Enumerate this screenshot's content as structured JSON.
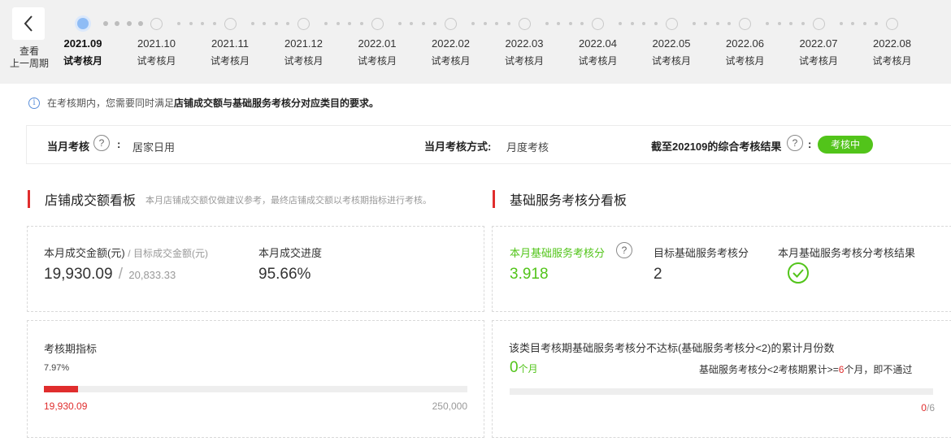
{
  "nav": {
    "prev_label_line1": "查看",
    "prev_label_line2": "上一周期"
  },
  "timeline": [
    {
      "month": "2021.09",
      "status": "试考核月",
      "active": true
    },
    {
      "month": "2021.10",
      "status": "试考核月",
      "active": false
    },
    {
      "month": "2021.11",
      "status": "试考核月",
      "active": false
    },
    {
      "month": "2021.12",
      "status": "试考核月",
      "active": false
    },
    {
      "month": "2022.01",
      "status": "试考核月",
      "active": false
    },
    {
      "month": "2022.02",
      "status": "试考核月",
      "active": false
    },
    {
      "month": "2022.03",
      "status": "试考核月",
      "active": false
    },
    {
      "month": "2022.04",
      "status": "试考核月",
      "active": false
    },
    {
      "month": "2022.05",
      "status": "试考核月",
      "active": false
    },
    {
      "month": "2022.06",
      "status": "试考核月",
      "active": false
    },
    {
      "month": "2022.07",
      "status": "试考核月",
      "active": false
    },
    {
      "month": "2022.08",
      "status": "试考核月",
      "active": false
    }
  ],
  "notice": {
    "prefix": "在考核期内，您需要同时满足",
    "bold": "店铺成交额与基础服务考核分对应类目的要求。"
  },
  "info_row": {
    "monthly_label": "当月考核",
    "category_value": "居家日用",
    "method_label": "当月考核方式:",
    "method_value": "月度考核",
    "result_label": "截至202109的综合考核结果",
    "result_badge": "考核中",
    "colon": ":"
  },
  "sales_board": {
    "title": "店铺成交额看板",
    "subtitle": "本月店铺成交额仅做建议参考，最终店铺成交额以考核期指标进行考核。",
    "amount_label": "本月成交金额(元)",
    "target_label": "/ 目标成交金额(元)",
    "amount_value": "19,930.09",
    "target_value": "20,833.33",
    "progress_label": "本月成交进度",
    "progress_value": "95.66%",
    "period_label": "考核期指标",
    "period_percent": "7.97%",
    "period_current": "19,930.09",
    "period_target": "250,000",
    "period_progress_fraction": 0.0797
  },
  "service_board": {
    "title": "基础服务考核分看板",
    "score_label": "本月基础服务考核分",
    "score_value": "3.918",
    "target_label": "目标基础服务考核分",
    "target_value": "2",
    "result_label": "本月基础服务考核分考核结果",
    "fail_label": "该类目考核期基础服务考核分不达标(基础服务考核分<2)的累计月份数",
    "fail_count": "0",
    "fail_unit": "个月",
    "rule_prefix": "基础服务考核分<2考核期累计>=",
    "rule_number": "6",
    "rule_suffix": "个月，即不通过",
    "counter_current": "0",
    "counter_total": "/6",
    "counter_fraction": 0
  },
  "colors": {
    "accent_red": "#e02d2d",
    "success_green": "#52c41a",
    "active_node_blue": "#8fbcf5"
  }
}
